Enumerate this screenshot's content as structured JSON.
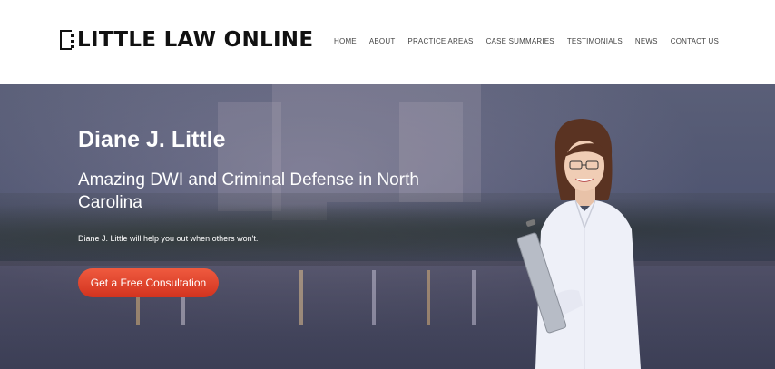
{
  "header": {
    "logo_text": "LITTLE LAW ONLINE",
    "nav": [
      "HOME",
      "ABOUT",
      "PRACTICE AREAS",
      "CASE SUMMARIES",
      "TESTIMONIALS",
      "NEWS",
      "CONTACT US"
    ]
  },
  "hero": {
    "title": "Diane J. Little",
    "subtitle": "Amazing DWI and Criminal Defense in North Carolina",
    "text": "Diane J. Little will help you out when others won't.",
    "cta_label": "Get a Free Consultation"
  },
  "colors": {
    "cta": "#e2402a",
    "hero_overlay": "#4e5470"
  }
}
